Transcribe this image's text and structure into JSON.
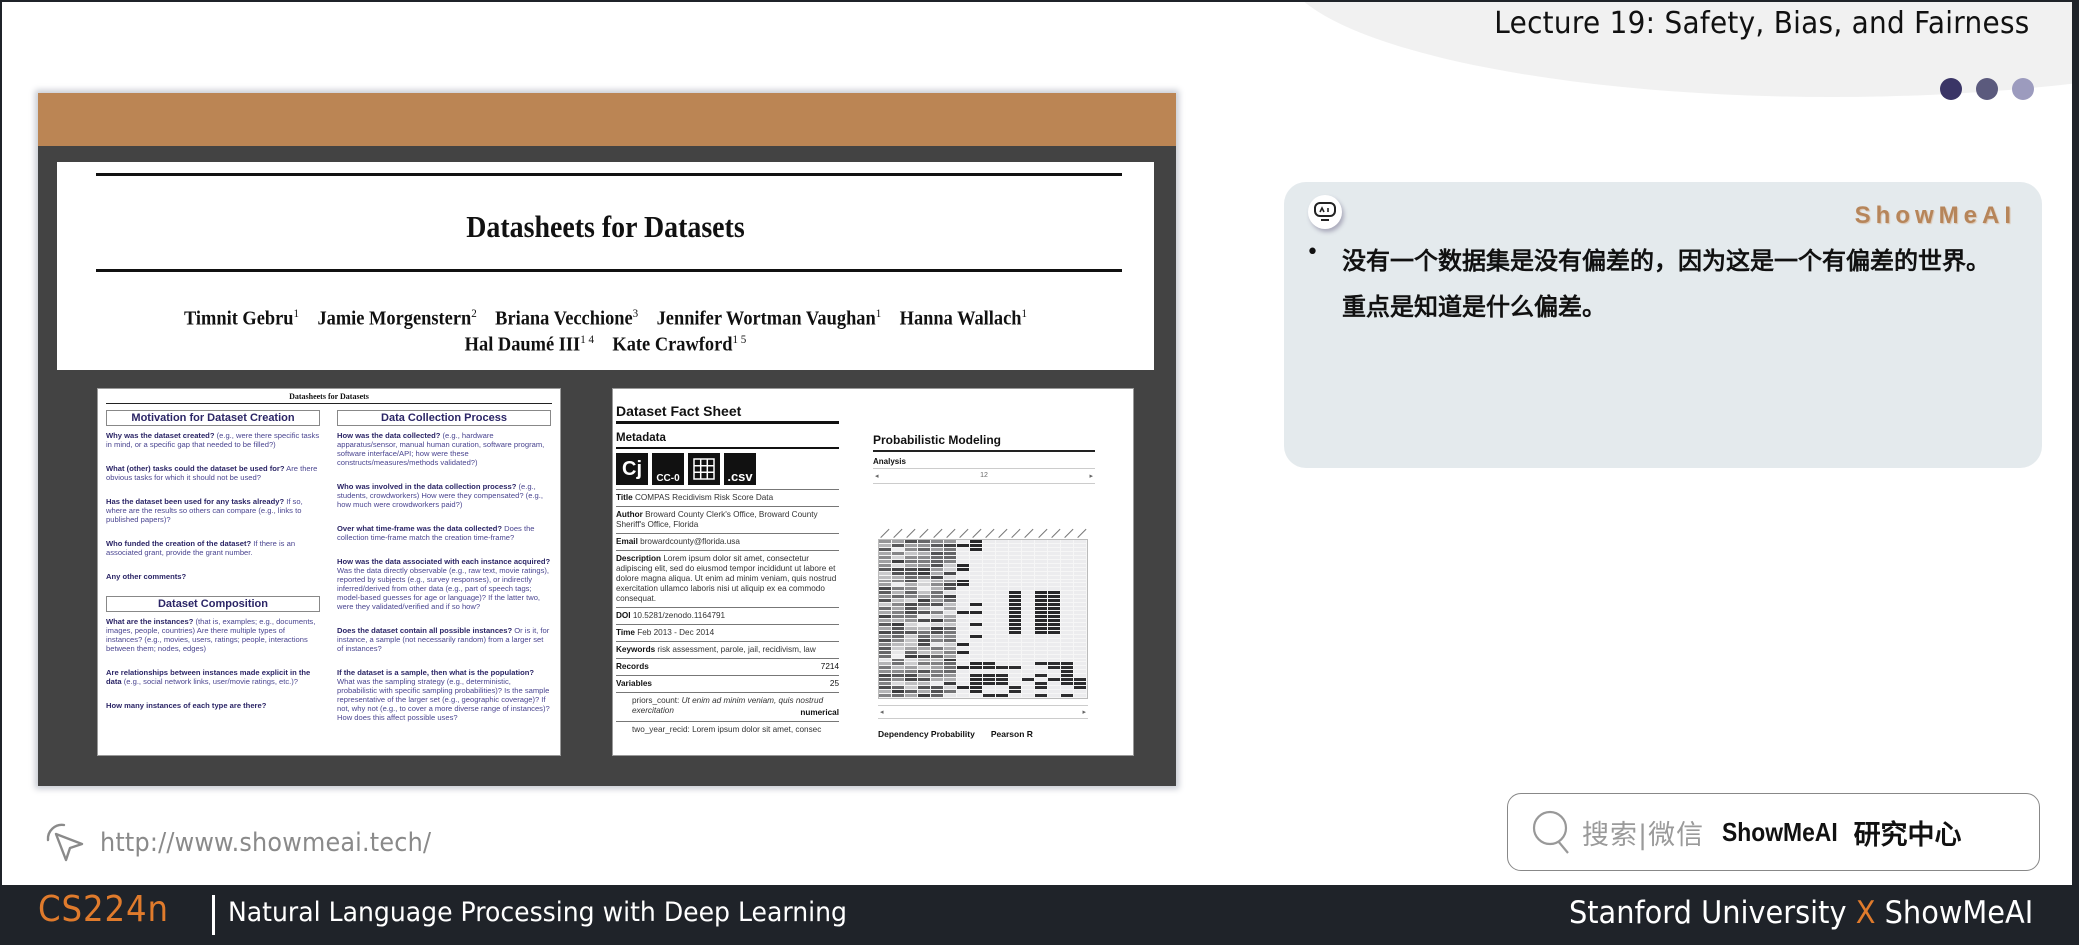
{
  "header": {
    "lecture_title": "Lecture 19: Safety, Bias, and Fairness",
    "dot_colors": [
      "#3a3566",
      "#5b5a7d",
      "#9c9bbe"
    ]
  },
  "paper": {
    "topbar_color": "#bb8554",
    "title": "Datasheets for Datasets",
    "authors_line1": [
      {
        "name": "Timnit Gebru",
        "aff": "1"
      },
      {
        "name": "Jamie Morgenstern",
        "aff": "2"
      },
      {
        "name": "Briana Vecchione",
        "aff": "3"
      },
      {
        "name": "Jennifer Wortman Vaughan",
        "aff": "1"
      },
      {
        "name": "Hanna Wallach",
        "aff": "1"
      }
    ],
    "authors_line2": [
      {
        "name": "Hal Daumé III",
        "aff": "1 4"
      },
      {
        "name": "Kate Crawford",
        "aff": "1 5"
      }
    ],
    "datasheet": {
      "running_head": "Datasheets for Datasets",
      "left_sections": [
        {
          "title": "Motivation for Dataset Creation",
          "questions": [
            {
              "q": "Why was the dataset created?",
              "detail": " (e.g., were there specific tasks in mind, or a specific gap that needed to be filled?)"
            },
            {
              "q": "What (other) tasks could the dataset be used for?",
              "detail": " Are there obvious tasks for which it should not be used?"
            },
            {
              "q": "Has the dataset been used for any tasks already?",
              "detail": " If so, where are the results so others can compare (e.g., links to published papers)?"
            },
            {
              "q": "Who funded the creation of the dataset?",
              "detail": " If there is an associated grant, provide the grant number."
            },
            {
              "q": "Any other comments?",
              "detail": ""
            }
          ]
        },
        {
          "title": "Dataset Composition",
          "questions": [
            {
              "q": "What are the instances?",
              "detail": " (that is, examples; e.g., documents, images, people, countries) Are there multiple types of instances? (e.g., movies, users, ratings; people, interactions between them; nodes, edges)"
            },
            {
              "q": "Are relationships between instances made explicit in the data",
              "detail": " (e.g., social network links, user/movie ratings, etc.)?"
            },
            {
              "q": "How many instances of each type are there?",
              "detail": ""
            }
          ]
        }
      ],
      "right_sections": [
        {
          "title": "Data Collection Process",
          "questions": [
            {
              "q": "How was the data collected?",
              "detail": " (e.g., hardware apparatus/sensor, manual human curation, software program, software interface/API; how were these constructs/measures/methods validated?)"
            },
            {
              "q": "Who was involved in the data collection process?",
              "detail": " (e.g., students, crowdworkers) How were they compensated? (e.g., how much were crowdworkers paid?)"
            },
            {
              "q": "Over what time-frame was the data collected?",
              "detail": " Does the collection time-frame match the creation time-frame?"
            },
            {
              "q": "How was the data associated with each instance acquired?",
              "detail": " Was the data directly observable (e.g., raw text, movie ratings), reported by subjects (e.g., survey responses), or indirectly inferred/derived from other data (e.g., part of speech tags; model-based guesses for age or language)? If the latter two, were they validated/verified and if so how?"
            },
            {
              "q": "Does the dataset contain all possible instances?",
              "detail": " Or is it, for instance, a sample (not necessarily random) from a larger set of instances?"
            },
            {
              "q": "If the dataset is a sample, then what is the population?",
              "detail": " What was the sampling strategy (e.g., deterministic, probabilistic with specific sampling probabilities)? Is the sample representative of the larger set (e.g., geographic coverage)? If not, why not (e.g., to cover a more diverse range of instances)? How does this affect possible uses?"
            }
          ]
        }
      ]
    },
    "factsheet": {
      "title": "Dataset Fact Sheet",
      "metadata_heading": "Metadata",
      "badges": [
        "Cj",
        "CC-0",
        "grid",
        ".csv"
      ],
      "rows": [
        {
          "label": "Title",
          "value": "COMPAS Recidivism Risk Score Data"
        },
        {
          "label": "Author",
          "value": "Broward County Clerk's Office, Broward County Sheriff's Office, Florida"
        },
        {
          "label": "Email",
          "value": "browardcounty@florida.usa"
        },
        {
          "label": "Description",
          "value": "Lorem ipsum dolor sit amet, consectetur adipiscing elit, sed do eiusmod tempor incididunt ut labore et dolore magna aliqua. Ut enim ad minim veniam, quis nostrud exercitation ullamco laboris nisi ut aliquip ex ea commodo consequat."
        },
        {
          "label": "DOI",
          "value": "10.5281/zenodo.1164791"
        },
        {
          "label": "Time",
          "value": "Feb 2013 - Dec 2014"
        },
        {
          "label": "Keywords",
          "value": "risk assessment, parole, jail, recidivism, law"
        }
      ],
      "records_label": "Records",
      "records_value": "7214",
      "variables_label": "Variables",
      "variables_value": "25",
      "variable_item": {
        "name": "priors_count:",
        "desc": "Ut enim ad minim veniam, quis nostrud exercitation",
        "kind": "numerical"
      },
      "variable_item_2": "two_year_recid: Lorem ipsum dolor sit amet, consec",
      "modeling_title": "Probabilistic Modeling",
      "analysis_label": "Analysis",
      "analysis_page": "12",
      "dependency_label": "Dependency Probability",
      "pearson_label": "Pearson R"
    }
  },
  "note_card": {
    "brand": "ShowMeAI",
    "bullet_text": "没有一个数据集是没有偏差的，因为这是一个有偏差的世界。重点是知道是什么偏差。"
  },
  "footer": {
    "url": "http://www.showmeai.tech/",
    "search_hint": "搜索|微信",
    "search_brand": "ShowMeAI",
    "search_brand_cn": "研究中心",
    "course_code": "CS224n",
    "course_name": "Natural Language Processing with Deep Learning",
    "partner_left": "Stanford University",
    "partner_x": "X",
    "partner_right": "ShowMeAI"
  }
}
